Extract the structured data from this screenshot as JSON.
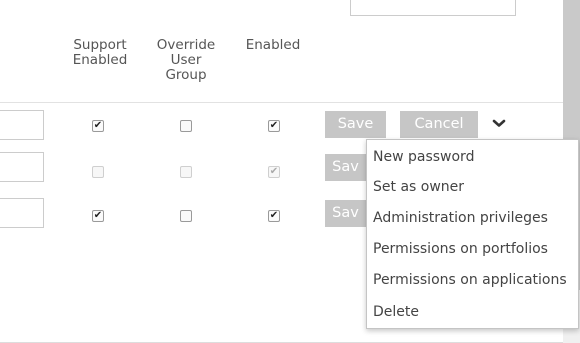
{
  "table": {
    "headers": [
      {
        "lines": [
          "Support",
          "Enabled"
        ]
      },
      {
        "lines": [
          "Override",
          "User",
          "Group"
        ]
      },
      {
        "lines": [
          "Enabled"
        ]
      }
    ],
    "rows": [
      {
        "support_enabled": true,
        "override_user_group": false,
        "enabled": true,
        "disabled": false
      },
      {
        "support_enabled": false,
        "override_user_group": false,
        "enabled": true,
        "disabled": true
      },
      {
        "support_enabled": true,
        "override_user_group": false,
        "enabled": true,
        "disabled": false
      }
    ]
  },
  "actions": {
    "save_label": "Save",
    "cancel_label": "Cancel",
    "row_save_partial": "Sav",
    "chevron_icon": "chevron-down-icon"
  },
  "dropdown": {
    "items": [
      "New password",
      "Set as owner",
      "Administration privileges",
      "Permissions on portfolios",
      "Permissions on applications",
      "Delete"
    ]
  },
  "colors": {
    "button_bg": "#c6c6c6",
    "scrollbar_thumb": "#c9c9c9"
  }
}
